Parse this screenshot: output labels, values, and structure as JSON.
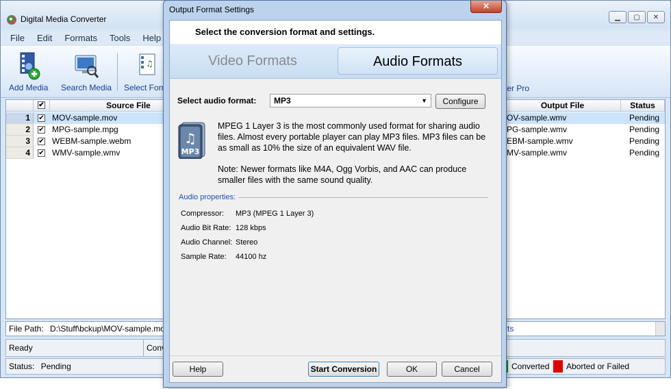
{
  "main": {
    "title": "Digital Media Converter",
    "menu": [
      "File",
      "Edit",
      "Formats",
      "Tools",
      "Help"
    ],
    "toolbar": {
      "add_media": "Add Media",
      "search_media": "Search Media",
      "select_format": "Select Format",
      "right_label": "ter Pro"
    },
    "columns": {
      "source_file": "Source File",
      "output_file": "Output File",
      "status": "Status"
    },
    "rows": [
      {
        "num": "1",
        "source": "MOV-sample.mov",
        "output": "OV-sample.wmv",
        "status": "Pending"
      },
      {
        "num": "2",
        "source": "MPG-sample.mpg",
        "output": "PG-sample.wmv",
        "status": "Pending"
      },
      {
        "num": "3",
        "source": "WEBM-sample.webm",
        "output": "EBM-sample.wmv",
        "status": "Pending"
      },
      {
        "num": "4",
        "source": "WMV-sample.wmv",
        "output": "MV-sample.wmv",
        "status": "Pending"
      }
    ],
    "path_label": "File Path:",
    "path_value": "D:\\Stuff\\bckup\\MOV-sample.mo",
    "path_link": "rts",
    "ready": "Ready",
    "ready_right": "Conv",
    "status_label": "Status:",
    "status_value": "Pending",
    "legend_converted": "Converted",
    "legend_aborted": "Aborted or Failed",
    "colors": {
      "converted": "#0f8a1e",
      "aborted": "#e00000"
    }
  },
  "dialog": {
    "title": "Output Format Settings",
    "close_glyph": "✕",
    "header": "Select the conversion format and settings.",
    "tab_video": "Video Formats",
    "tab_audio": "Audio Formats",
    "select_label": "Select audio format:",
    "select_value": "MP3",
    "configure": "Configure",
    "icon_label": "MP3",
    "description": "MPEG 1 Layer 3 is the most commonly used format for sharing audio files. Almost every portable player can play MP3 files.  MP3 files can be as small as 10% the size of an equivalent WAV file.",
    "note": "Note: Newer formats like M4A, Ogg Vorbis, and AAC can produce smaller files with the same sound quality.",
    "props_heading": "Audio properties:",
    "props": [
      {
        "key": "Compressor:",
        "value": "MP3 (MPEG 1 Layer 3)"
      },
      {
        "key": "Audio Bit Rate:",
        "value": "128 kbps"
      },
      {
        "key": "Audio Channel:",
        "value": "Stereo"
      },
      {
        "key": "Sample Rate:",
        "value": "44100 hz"
      }
    ],
    "btn_help": "Help",
    "btn_start": "Start Conversion",
    "btn_ok": "OK",
    "btn_cancel": "Cancel"
  }
}
